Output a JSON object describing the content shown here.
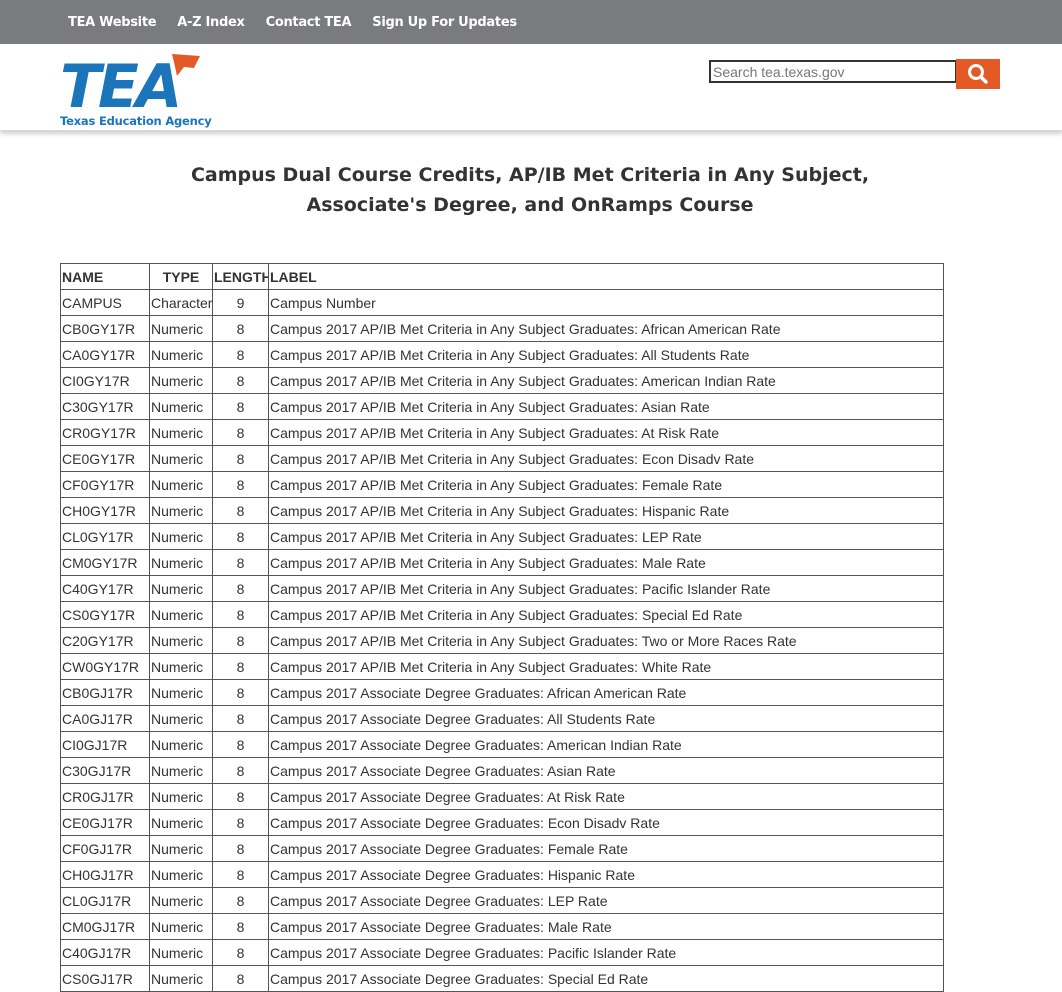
{
  "topnav": {
    "items": [
      {
        "label": "TEA Website"
      },
      {
        "label": "A-Z Index"
      },
      {
        "label": "Contact TEA"
      },
      {
        "label": "Sign Up For Updates"
      }
    ]
  },
  "header": {
    "logo_text": "TEA",
    "logo_tagline": "Texas Education Agency",
    "search": {
      "placeholder": "Search tea.texas.gov",
      "value": "",
      "button_icon": "search-icon"
    }
  },
  "colors": {
    "topbar": "#7a7b7e",
    "brand_blue": "#1b75bb",
    "accent_orange": "#e35a24"
  },
  "page": {
    "title_line1": "Campus Dual Course Credits, AP/IB Met Criteria in Any Subject,",
    "title_line2": "Associate's Degree, and OnRamps Course"
  },
  "table": {
    "headers": {
      "name": "NAME",
      "type": "TYPE",
      "length": "LENGTH",
      "label": "LABEL"
    },
    "rows": [
      {
        "name": "CAMPUS",
        "type": "Character",
        "length": "9",
        "label": "Campus Number"
      },
      {
        "name": "CB0GY17R",
        "type": "Numeric",
        "length": "8",
        "label": "Campus 2017 AP/IB Met Criteria in Any Subject Graduates: African American Rate"
      },
      {
        "name": "CA0GY17R",
        "type": "Numeric",
        "length": "8",
        "label": "Campus 2017 AP/IB Met Criteria in Any Subject Graduates: All Students Rate"
      },
      {
        "name": "CI0GY17R",
        "type": "Numeric",
        "length": "8",
        "label": "Campus 2017 AP/IB Met Criteria in Any Subject Graduates: American Indian Rate"
      },
      {
        "name": "C30GY17R",
        "type": "Numeric",
        "length": "8",
        "label": "Campus 2017 AP/IB Met Criteria in Any Subject Graduates: Asian Rate"
      },
      {
        "name": "CR0GY17R",
        "type": "Numeric",
        "length": "8",
        "label": "Campus 2017 AP/IB Met Criteria in Any Subject Graduates: At Risk Rate"
      },
      {
        "name": "CE0GY17R",
        "type": "Numeric",
        "length": "8",
        "label": "Campus 2017 AP/IB Met Criteria in Any Subject Graduates: Econ Disadv Rate"
      },
      {
        "name": "CF0GY17R",
        "type": "Numeric",
        "length": "8",
        "label": "Campus 2017 AP/IB Met Criteria in Any Subject Graduates: Female Rate"
      },
      {
        "name": "CH0GY17R",
        "type": "Numeric",
        "length": "8",
        "label": "Campus 2017 AP/IB Met Criteria in Any Subject Graduates: Hispanic Rate"
      },
      {
        "name": "CL0GY17R",
        "type": "Numeric",
        "length": "8",
        "label": "Campus 2017 AP/IB Met Criteria in Any Subject Graduates: LEP Rate"
      },
      {
        "name": "CM0GY17R",
        "type": "Numeric",
        "length": "8",
        "label": "Campus 2017 AP/IB Met Criteria in Any Subject Graduates: Male Rate"
      },
      {
        "name": "C40GY17R",
        "type": "Numeric",
        "length": "8",
        "label": "Campus 2017 AP/IB Met Criteria in Any Subject Graduates: Pacific Islander Rate"
      },
      {
        "name": "CS0GY17R",
        "type": "Numeric",
        "length": "8",
        "label": "Campus 2017 AP/IB Met Criteria in Any Subject Graduates: Special Ed Rate"
      },
      {
        "name": "C20GY17R",
        "type": "Numeric",
        "length": "8",
        "label": "Campus 2017 AP/IB Met Criteria in Any Subject Graduates: Two or More Races Rate"
      },
      {
        "name": "CW0GY17R",
        "type": "Numeric",
        "length": "8",
        "label": "Campus 2017 AP/IB Met Criteria in Any Subject Graduates: White Rate"
      },
      {
        "name": "CB0GJ17R",
        "type": "Numeric",
        "length": "8",
        "label": "Campus 2017 Associate Degree Graduates: African American Rate"
      },
      {
        "name": "CA0GJ17R",
        "type": "Numeric",
        "length": "8",
        "label": "Campus 2017 Associate Degree Graduates: All Students Rate"
      },
      {
        "name": "CI0GJ17R",
        "type": "Numeric",
        "length": "8",
        "label": "Campus 2017 Associate Degree Graduates: American Indian Rate"
      },
      {
        "name": "C30GJ17R",
        "type": "Numeric",
        "length": "8",
        "label": "Campus 2017 Associate Degree Graduates: Asian Rate"
      },
      {
        "name": "CR0GJ17R",
        "type": "Numeric",
        "length": "8",
        "label": "Campus 2017 Associate Degree Graduates: At Risk Rate"
      },
      {
        "name": "CE0GJ17R",
        "type": "Numeric",
        "length": "8",
        "label": "Campus 2017 Associate Degree Graduates: Econ Disadv Rate"
      },
      {
        "name": "CF0GJ17R",
        "type": "Numeric",
        "length": "8",
        "label": "Campus 2017 Associate Degree Graduates: Female Rate"
      },
      {
        "name": "CH0GJ17R",
        "type": "Numeric",
        "length": "8",
        "label": "Campus 2017 Associate Degree Graduates: Hispanic Rate"
      },
      {
        "name": "CL0GJ17R",
        "type": "Numeric",
        "length": "8",
        "label": "Campus 2017 Associate Degree Graduates: LEP Rate"
      },
      {
        "name": "CM0GJ17R",
        "type": "Numeric",
        "length": "8",
        "label": "Campus 2017 Associate Degree Graduates: Male Rate"
      },
      {
        "name": "C40GJ17R",
        "type": "Numeric",
        "length": "8",
        "label": "Campus 2017 Associate Degree Graduates: Pacific Islander Rate"
      },
      {
        "name": "CS0GJ17R",
        "type": "Numeric",
        "length": "8",
        "label": "Campus 2017 Associate Degree Graduates: Special Ed Rate"
      }
    ]
  }
}
